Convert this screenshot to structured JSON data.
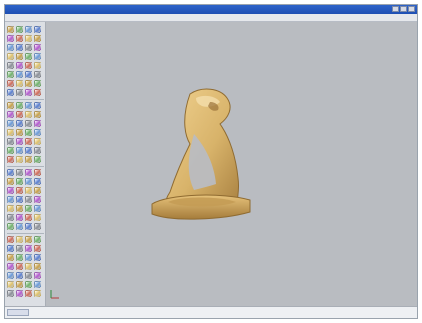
{
  "window": {
    "title": "",
    "buttons": [
      "minimize",
      "maximize",
      "close"
    ]
  },
  "menu": {
    "items": []
  },
  "toolbar": {
    "tool_count": 0
  },
  "viewport": {
    "background_color": "#b9bcc1",
    "object": "3d-printed-stirrup-shaped-model"
  },
  "status": {
    "coordinates": ""
  },
  "colors": {
    "titlebar": "#2e63c9",
    "viewport": "#b9bcc1",
    "object": "#d9b56a"
  }
}
